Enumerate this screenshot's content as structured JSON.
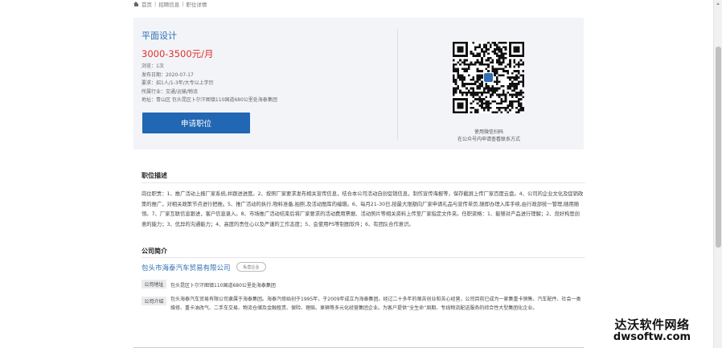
{
  "breadcrumb": {
    "home": "首页",
    "separator": "|",
    "level2": "招聘信息",
    "level3": "职位详情"
  },
  "job": {
    "title": "平面设计",
    "salary": "3000-3500元/月",
    "views": "浏览：1次",
    "published": "发布日期：2020-07-17",
    "requirements": "要求：招1人/1-3年/大专以上学历",
    "industry": "所属行业：交通/运输/物流",
    "address": "地址：青山区 包头昆区卜尔汗图镇110国道680公里处海泰集团",
    "apply_label": "申请职位"
  },
  "qr": {
    "icon": "qr-code-icon",
    "caption_line1": "使用微信扫码",
    "caption_line2": "在公众号内申请查看联系方式"
  },
  "description": {
    "heading": "职位描述",
    "text": "岗位职责：1、推广活动上报厂家系统,并跟进进度。2、按照厂家要求发布相关宣传信息，结合本公司活动自创促销信息，制作宣传海报等，保存截屏上传厂家百度云盘。4、公司的企业文化及促销政策的推广，对相关政策节点进行把推。5、推广活动的执行,物料准备,拍照,及活动图库的编辑。6、每月21-30日,按最大限额向厂家申请礼品与宣传单页,随即办理入库手续,由行政部统一管理,随用随领。7、厂家互联信息跟进，客户信息录入。8、市场推广活动结束后将厂家要求的活动费用票据、活动照片等相关资料上传至厂家指定文件夹。任职资格：1、能够对产品进行理解；2、良好构思创意的能力；3、优异的沟通能力；4、高度的责任心以及严谨的工作态度；5、会使用PS等制图软件；6、有团队合作意识。"
  },
  "company": {
    "heading": "公司简介",
    "name": "包头市海泰汽车贸易有限公司",
    "tag": "私营企业",
    "address_label": "公司地址",
    "address": "包头昆区卜尔汗图镇110国道680公里处海泰集团",
    "intro_label": "公司介绍",
    "intro": "包头海泰汽车贸易有限公司隶属于海泰集团。海泰汽修始创于1995年，于2009年成立为海泰集团。经过二十多年的艰苦创业和苦心经营，公司目前已成为一家集重卡销售、汽车配件、社会一类维修、重卡油改气、二手车交易、物流仓储及金融租赁、保险、理赔、車辆等多元化经营集团企业。为客户提供“全生命”周期、专线物流配送服务的综合性大型集团化企业。"
  },
  "watermark": {
    "line1": "达沃软件网络",
    "line2": "dwsoftw.com"
  },
  "colors": {
    "accent_blue": "#2e6fb5",
    "button_blue": "#2167b3",
    "salary_red": "#e0312a",
    "card_bg": "#f3f4f8"
  }
}
